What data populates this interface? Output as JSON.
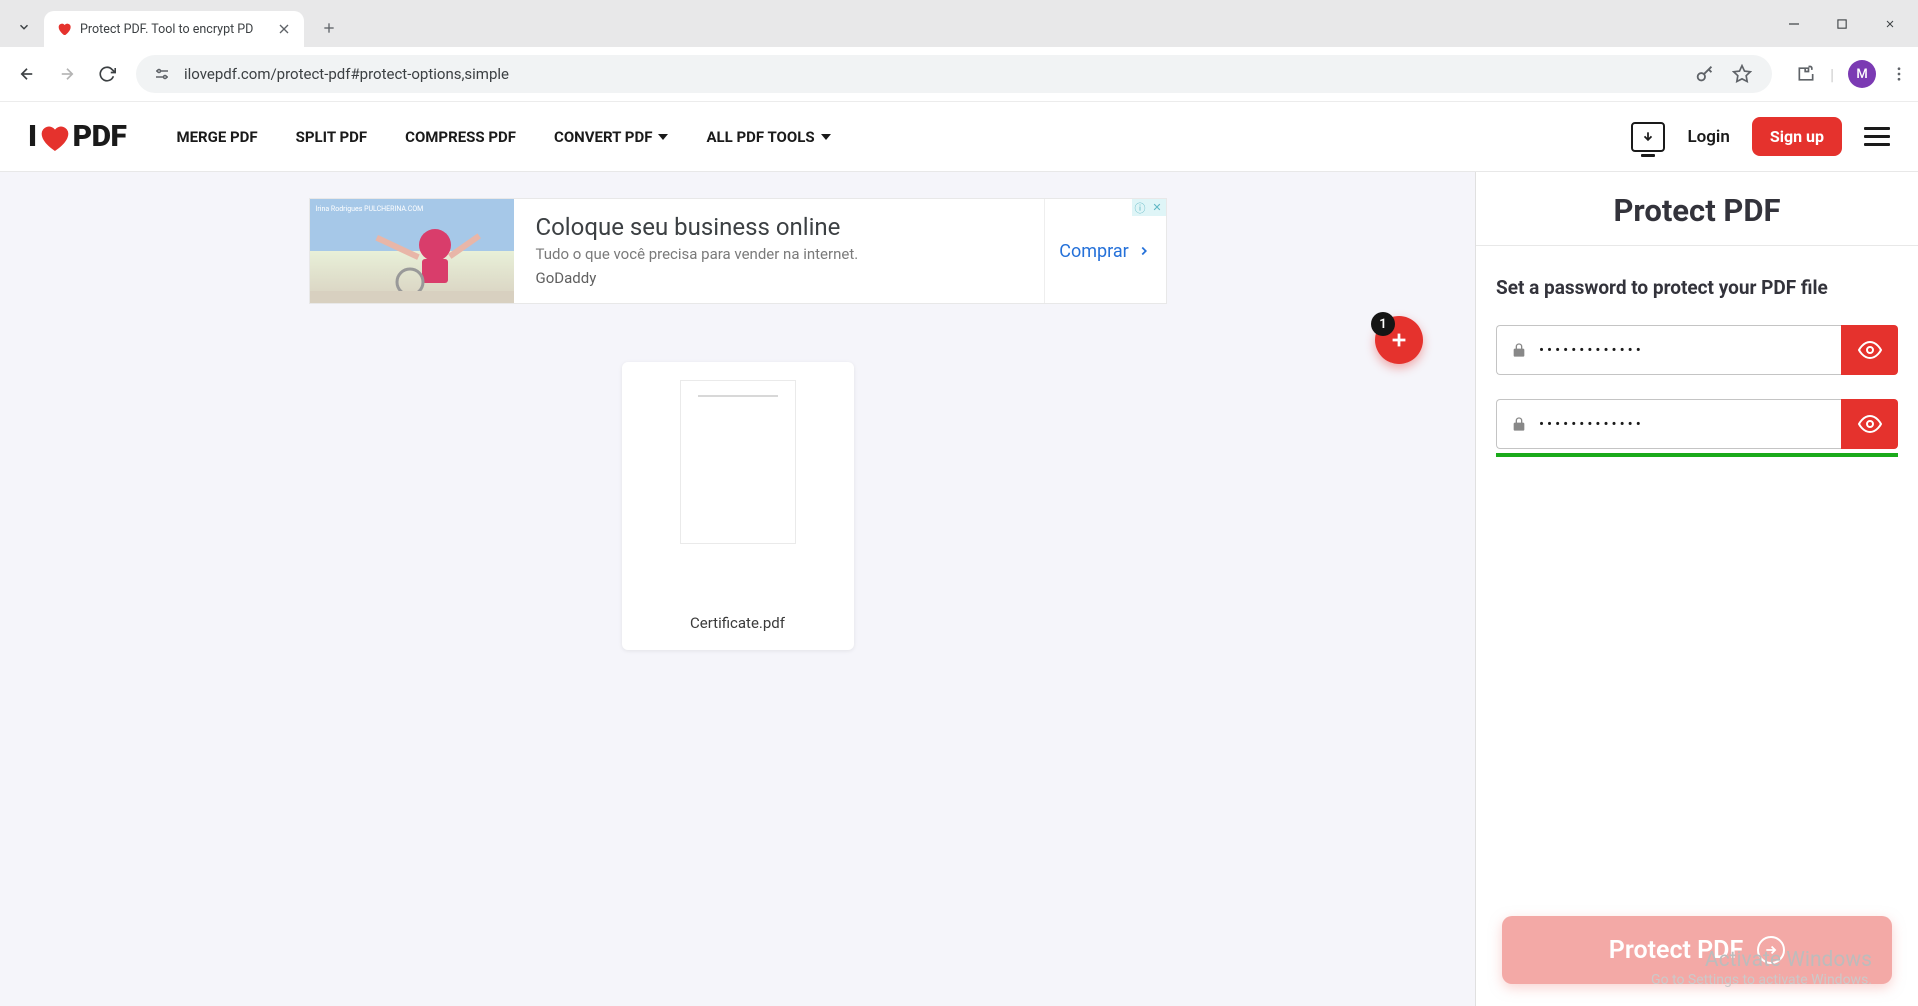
{
  "browser": {
    "tab_title": "Protect PDF. Tool to encrypt PD",
    "url": "ilovepdf.com/protect-pdf#protect-options,simple",
    "avatar_letter": "M"
  },
  "header": {
    "logo_prefix": "I",
    "logo_suffix": "PDF",
    "nav": {
      "merge": "MERGE PDF",
      "split": "SPLIT PDF",
      "compress": "COMPRESS PDF",
      "convert": "CONVERT PDF",
      "all": "ALL PDF TOOLS"
    },
    "login": "Login",
    "signup": "Sign up"
  },
  "ad": {
    "attribution": "Irina Rodrigues\nPULCHERINA.COM",
    "title": "Coloque seu business online",
    "subtitle": "Tudo o que você precisa para vender na internet.",
    "brand": "GoDaddy",
    "cta": "Comprar"
  },
  "files": {
    "badge_count": "1",
    "file_name": "Certificate.pdf"
  },
  "sidebar": {
    "title": "Protect PDF",
    "subtitle": "Set a password to protect your PDF file",
    "password_value": "•••••••••••••",
    "confirm_value": "•••••••••••••",
    "action": "Protect PDF"
  },
  "watermark": {
    "line1": "Activate Windows",
    "line2": "Go to Settings to activate Windows."
  }
}
